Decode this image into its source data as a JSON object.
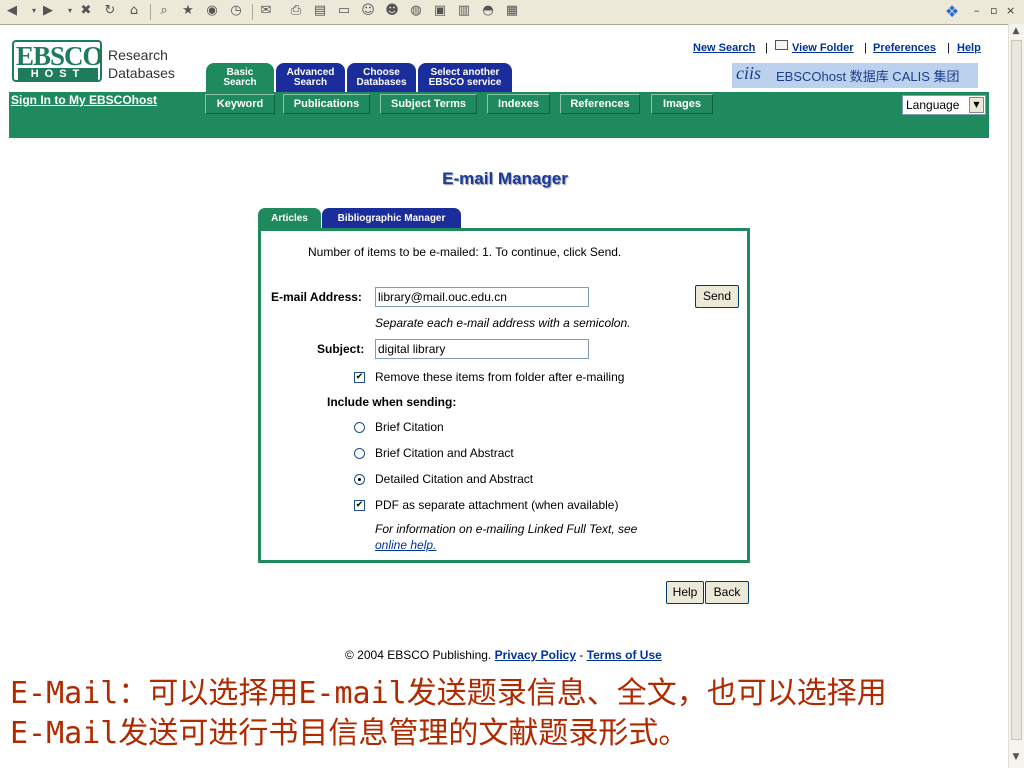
{
  "browser": {
    "toolbar_icons": [
      "back-icon",
      "forward-icon",
      "stop-icon",
      "refresh-icon",
      "home-icon",
      "search-icon",
      "favorites-icon",
      "media-icon",
      "history-icon",
      "mail-icon",
      "print-icon",
      "edit-icon",
      "discuss-icon",
      "messenger-icon",
      "misc-icon",
      "misc2-icon",
      "misc3-icon",
      "misc4-icon",
      "misc5-icon",
      "misc6-icon"
    ]
  },
  "header": {
    "logo_brand": "EBSCO",
    "logo_host": "HOST",
    "logo_line1": "Research",
    "logo_line2": "Databases",
    "tabs": [
      {
        "line1": "Basic",
        "line2": "Search",
        "active": true
      },
      {
        "line1": "Advanced",
        "line2": "Search",
        "active": false
      },
      {
        "line1": "Choose",
        "line2": "Databases",
        "active": false
      },
      {
        "line1": "Select another",
        "line2": "EBSCO service",
        "active": false
      }
    ],
    "top_links": {
      "new_search": "New Search",
      "view_folder": "View Folder",
      "preferences": "Preferences",
      "help": "Help",
      "separator": "|"
    },
    "calis_banner": "EBSCOhost 数据库 CALIS 集团",
    "calis_mark": "ciis"
  },
  "nav": {
    "sign_in": "Sign In to My EBSCOhost",
    "subtabs": [
      "Keyword",
      "Publications",
      "Subject Terms",
      "Indexes",
      "References",
      "Images"
    ],
    "language": "Language"
  },
  "email_manager": {
    "title": "E-mail  Manager",
    "tabs": [
      "Articles",
      "Bibliographic Manager"
    ],
    "items_text": "Number of items to be e-mailed: 1. To continue, click Send.",
    "email_label": "E-mail Address:",
    "email_value": "library@mail.ouc.edu.cn",
    "send_button": "Send",
    "email_hint": "Separate each e-mail address with a semicolon.",
    "subject_label": "Subject:",
    "subject_value": "digital library",
    "remove_label": "Remove these items from folder after e-mailing",
    "remove_checked": true,
    "include_label": "Include when sending:",
    "options": [
      {
        "label": "Brief Citation",
        "selected": false
      },
      {
        "label": "Brief Citation and Abstract",
        "selected": false
      },
      {
        "label": "Detailed Citation and Abstract",
        "selected": true
      }
    ],
    "pdf_label": "PDF as separate attachment (when available)",
    "pdf_checked": true,
    "info_text": "For information on e-mailing Linked Full Text, see",
    "info_link": "online help."
  },
  "actions": {
    "help": "Help",
    "back": "Back"
  },
  "footer": {
    "copyright": "© 2004 EBSCO Publishing.",
    "privacy": "Privacy Policy",
    "dash": "-",
    "terms": "Terms of Use"
  },
  "annotation": {
    "line1": "E-Mail：可以选择用E-mail发送题录信息、全文，也可以选择用",
    "line2": "E-Mail发送可进行书目信息管理的文献题录形式。"
  },
  "colors": {
    "green": "#1f8a5e",
    "blue": "#1a2d9a",
    "link": "#003399",
    "annotation": "#b02a00"
  }
}
